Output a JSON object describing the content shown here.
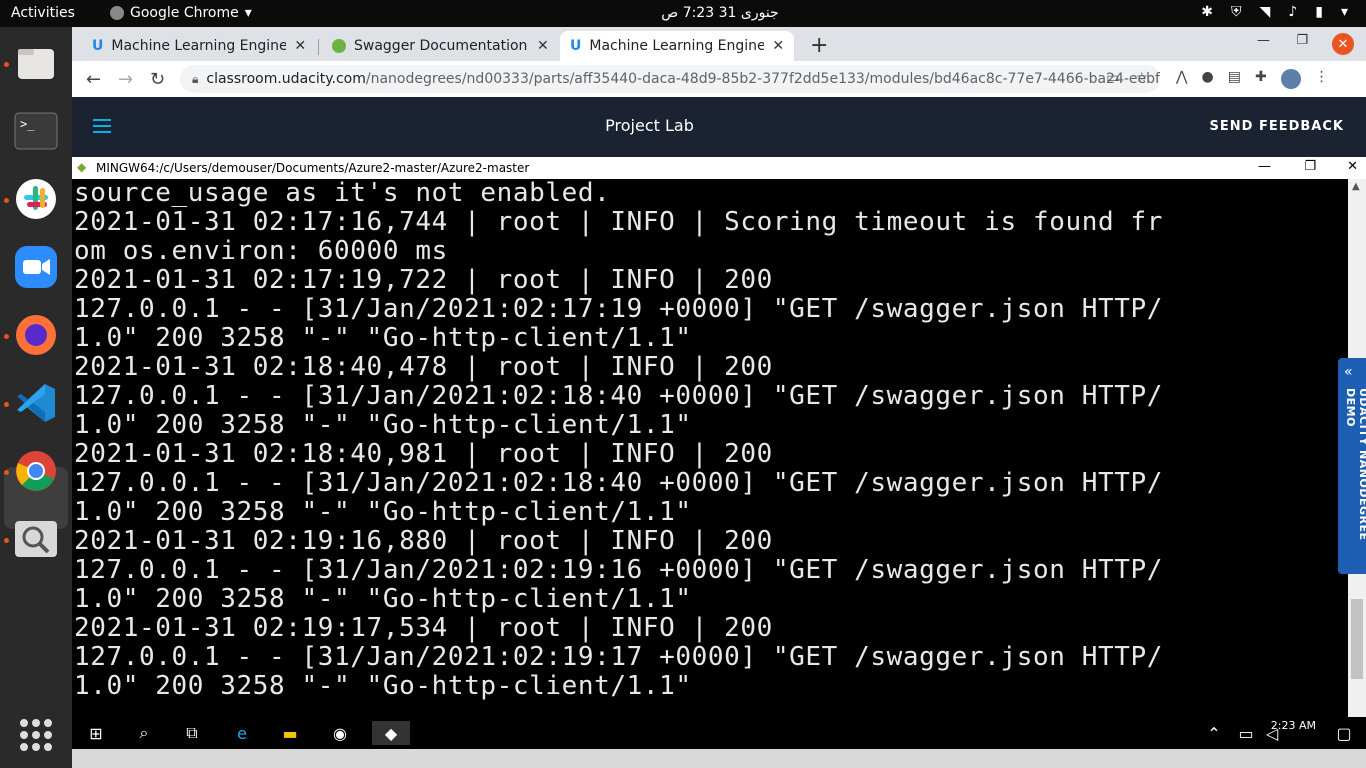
{
  "topbar": {
    "activities": "Activities",
    "app_name": "Google Chrome",
    "clock": "جنوری 31  7:23 ص"
  },
  "dock": {
    "apps": [
      "files-icon",
      "terminal-icon",
      "slack-icon",
      "zoom-icon",
      "firefox-icon",
      "vscode-icon",
      "chrome-icon",
      "search-tool-icon"
    ]
  },
  "browser": {
    "tabs": [
      {
        "title": "Machine Learning Engine",
        "close": "✕"
      },
      {
        "title": "Swagger Documentation",
        "close": "✕"
      },
      {
        "title": "Machine Learning Engine",
        "close": "✕"
      }
    ],
    "new_tab": "+",
    "url_host": "classroom.udacity.com",
    "url_path": "/nanodegrees/nd00333/parts/aff35440-daca-48d9-85b2-377f2dd5e133/modules/bd46ac8c-77e7-4466-ba24-eebf…"
  },
  "page": {
    "title": "Project Lab",
    "feedback": "SEND FEEDBACK",
    "side_tab": "UDACITY NANODEGREE DEMO"
  },
  "terminal": {
    "title": "MINGW64:/c/Users/demouser/Documents/Azure2-master/Azure2-master",
    "lines": [
      "source_usage as it's not enabled.",
      "2021-01-31 02:17:16,744 | root | INFO | Scoring timeout is found fr",
      "om os.environ: 60000 ms",
      "2021-01-31 02:17:19,722 | root | INFO | 200",
      "127.0.0.1 - - [31/Jan/2021:02:17:19 +0000] \"GET /swagger.json HTTP/",
      "1.0\" 200 3258 \"-\" \"Go-http-client/1.1\"",
      "2021-01-31 02:18:40,478 | root | INFO | 200",
      "127.0.0.1 - - [31/Jan/2021:02:18:40 +0000] \"GET /swagger.json HTTP/",
      "1.0\" 200 3258 \"-\" \"Go-http-client/1.1\"",
      "2021-01-31 02:18:40,981 | root | INFO | 200",
      "127.0.0.1 - - [31/Jan/2021:02:18:40 +0000] \"GET /swagger.json HTTP/",
      "1.0\" 200 3258 \"-\" \"Go-http-client/1.1\"",
      "2021-01-31 02:19:16,880 | root | INFO | 200",
      "127.0.0.1 - - [31/Jan/2021:02:19:16 +0000] \"GET /swagger.json HTTP/",
      "1.0\" 200 3258 \"-\" \"Go-http-client/1.1\"",
      "2021-01-31 02:19:17,534 | root | INFO | 200",
      "127.0.0.1 - - [31/Jan/2021:02:19:17 +0000] \"GET /swagger.json HTTP/",
      "1.0\" 200 3258 \"-\" \"Go-http-client/1.1\""
    ]
  },
  "windows_taskbar": {
    "time": "2:23 AM"
  },
  "colors": {
    "ubuntu_accent": "#e95420",
    "udacity_header": "#1b2332",
    "udacity_blue": "#1e5fb4"
  }
}
